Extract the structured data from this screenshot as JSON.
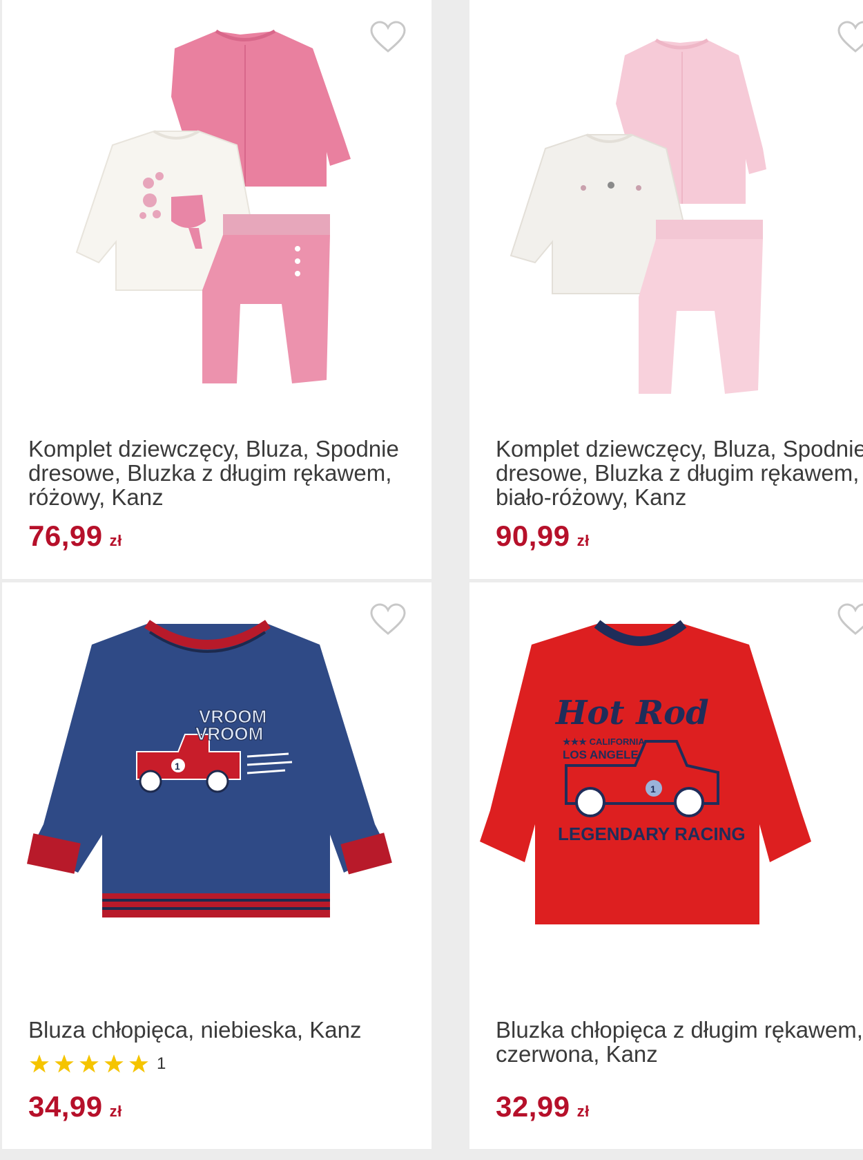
{
  "colors": {
    "price": "#b6102a",
    "star": "#f5c400",
    "page_bg": "#ececec"
  },
  "products": [
    {
      "title": "Komplet dziewczęcy, Bluza, Spodnie dresowe, Bluzka z długim rękawem, różowy, Kanz",
      "price": "76,99",
      "currency": "zł",
      "favorite_icon": "heart-outline-icon"
    },
    {
      "title": "Komplet dziewczęcy, Bluza, Spodnie dresowe, Bluzka z długim rękawem, biało-różowy, Kanz",
      "price": "90,99",
      "currency": "zł",
      "favorite_icon": "heart-outline-icon"
    },
    {
      "title": "Bluza chłopięca, niebieska, Kanz",
      "rating": {
        "stars": 5,
        "count": "1"
      },
      "price": "34,99",
      "currency": "zł",
      "favorite_icon": "heart-outline-icon",
      "image_text": [
        "VROOM",
        "VROOM",
        "1"
      ]
    },
    {
      "title": "Bluzka chłopięca z długim rękawem, czerwona, Kanz",
      "price": "32,99",
      "currency": "zł",
      "favorite_icon": "heart-outline-icon",
      "image_text": [
        "Hot Rod",
        "★★★ CALIFORNIA",
        "LOS ANGELES",
        "1",
        "LEGENDARY RACING"
      ]
    }
  ]
}
